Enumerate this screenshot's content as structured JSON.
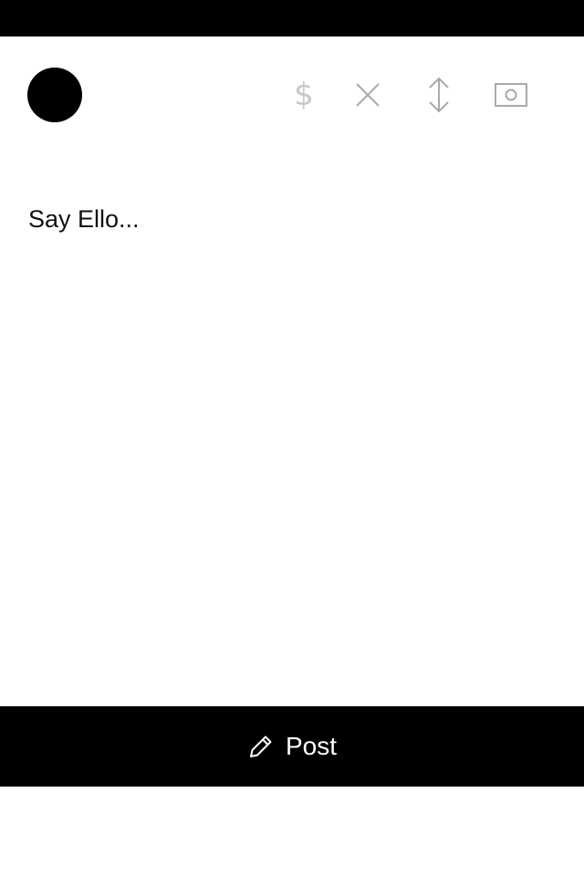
{
  "colors": {
    "status_bar": "#000000",
    "avatar": "#000000",
    "icon_gray": "#aaaaaa",
    "icon_light_gray": "#c8c8c8",
    "post_bar": "#000000",
    "post_text": "#ffffff"
  },
  "toolbar": {
    "sell_glyph": "$",
    "icons": [
      "dollar-icon",
      "close-icon",
      "reorder-icon",
      "camera-icon"
    ]
  },
  "editor": {
    "text": "Say Ello..."
  },
  "post_button": {
    "icon": "pencil-icon",
    "label": "Post"
  }
}
